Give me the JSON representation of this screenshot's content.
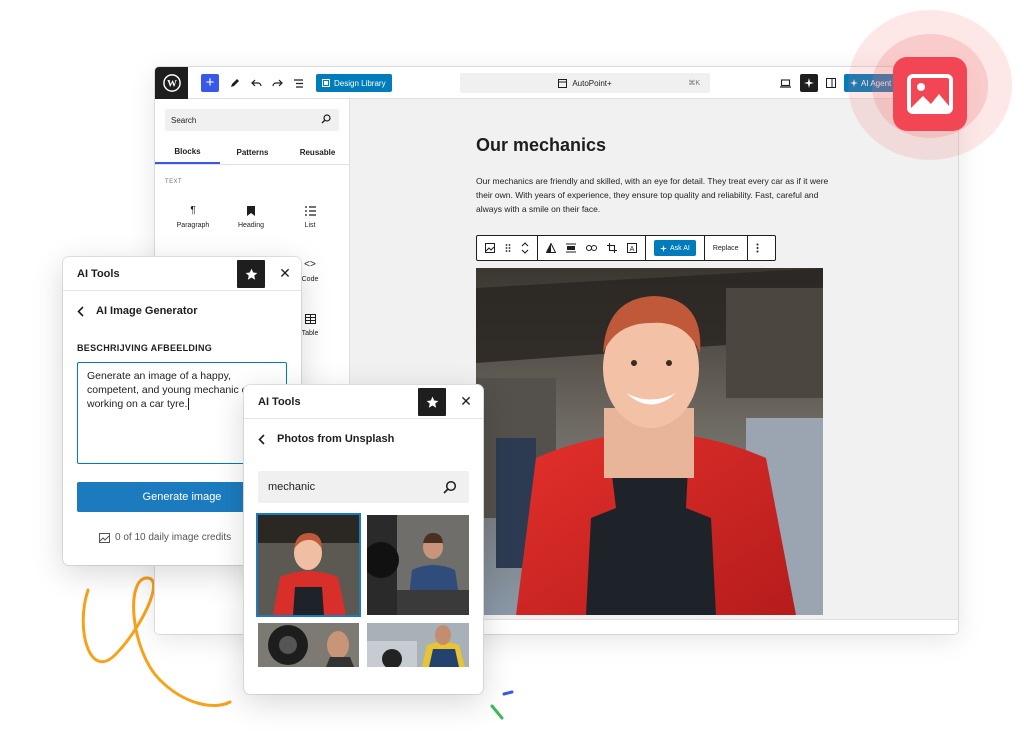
{
  "colors": {
    "accent": "#007cba",
    "wp_blue": "#3858e9",
    "icon_red": "#f24654",
    "squiggle": "#f7a21b"
  },
  "topbar": {
    "design_library": "Design Library",
    "command_title": "AutoPoint+",
    "command_shortcut": "⌘K",
    "ai_agent": "AI Agent"
  },
  "inserter": {
    "search_placeholder": "Search",
    "tabs": [
      "Blocks",
      "Patterns",
      "Reusable"
    ],
    "category": "TEXT",
    "blocks": [
      {
        "label": "Paragraph",
        "icon": "paragraph-icon"
      },
      {
        "label": "Heading",
        "icon": "bookmark-icon"
      },
      {
        "label": "List",
        "icon": "list-icon"
      },
      {
        "label": "Code",
        "icon": "code-icon"
      },
      {
        "label": "Table",
        "icon": "table-icon"
      }
    ]
  },
  "post": {
    "title": "Our mechanics",
    "paragraph": "Our mechanics are friendly and skilled, with an eye for detail. They treat every car as if it were their own. With years of experience, they ensure top quality and reliability. Fast, careful and always with a smile on their face.",
    "toolbar": {
      "ask_ai": "Ask AI",
      "replace": "Replace"
    }
  },
  "panel_generator": {
    "title": "AI Tools",
    "subtitle": "AI Image Generator",
    "label": "BESCHRIJVING AFBEELDING",
    "prompt": "Generate an image of a happy, competent, and young mechanic car or working on a car tyre.",
    "button": "Generate image",
    "credits": "0 of 10 daily image credits"
  },
  "panel_unsplash": {
    "title": "AI Tools",
    "subtitle": "Photos from Unsplash",
    "query": "mechanic"
  }
}
